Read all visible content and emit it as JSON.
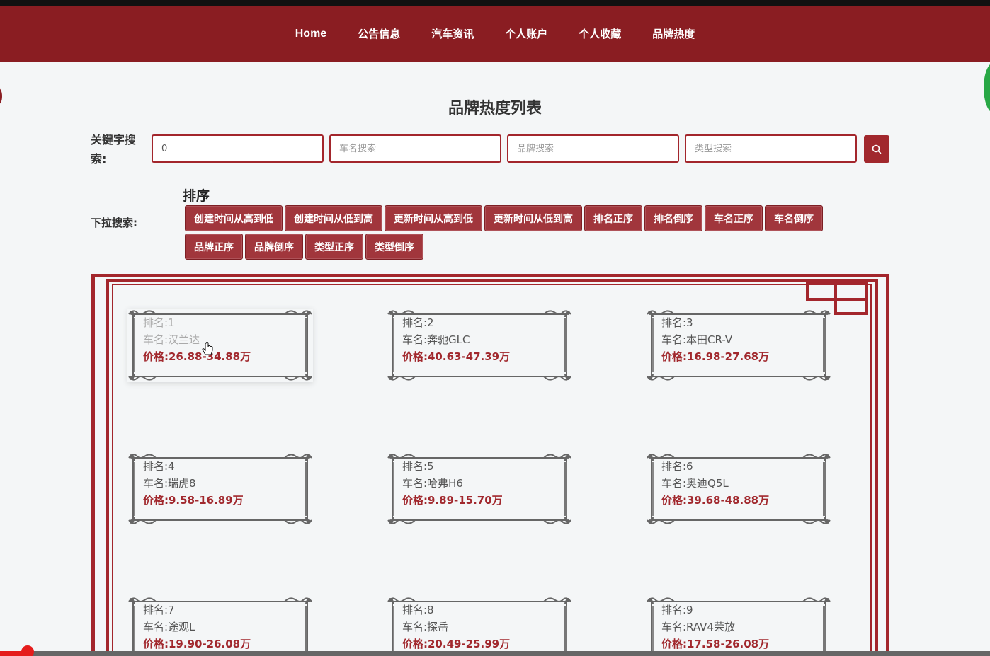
{
  "nav": {
    "items": [
      {
        "label": "Home"
      },
      {
        "label": "公告信息"
      },
      {
        "label": "汽车资讯"
      },
      {
        "label": "个人账户"
      },
      {
        "label": "个人收藏"
      },
      {
        "label": "品牌热度"
      }
    ]
  },
  "page": {
    "title": "品牌热度列表"
  },
  "search": {
    "label": "关键字搜索:",
    "keyword_value": "0",
    "car_placeholder": "车名搜索",
    "brand_placeholder": "品牌搜索",
    "type_placeholder": "类型搜索",
    "button_icon": "search-icon"
  },
  "sort": {
    "title": "排序",
    "label": "下拉搜索:",
    "buttons": [
      "创建时间从高到低",
      "创建时间从低到高",
      "更新时间从高到低",
      "更新时间从低到高",
      "排名正序",
      "排名倒序",
      "车名正序",
      "车名倒序",
      "品牌正序",
      "品牌倒序",
      "类型正序",
      "类型倒序"
    ]
  },
  "cards": [
    {
      "rank": "排名:1",
      "name": "车名:汉兰达",
      "price": "价格:26.88-34.88万"
    },
    {
      "rank": "排名:2",
      "name": "车名:奔驰GLC",
      "price": "价格:40.63-47.39万"
    },
    {
      "rank": "排名:3",
      "name": "车名:本田CR-V",
      "price": "价格:16.98-27.68万"
    },
    {
      "rank": "排名:4",
      "name": "车名:瑞虎8",
      "price": "价格:9.58-16.89万"
    },
    {
      "rank": "排名:5",
      "name": "车名:哈弗H6",
      "price": "价格:9.89-15.70万"
    },
    {
      "rank": "排名:6",
      "name": "车名:奥迪Q5L",
      "price": "价格:39.68-48.88万"
    },
    {
      "rank": "排名:7",
      "name": "车名:途观L",
      "price": "价格:19.90-26.08万"
    },
    {
      "rank": "排名:8",
      "name": "车名:探岳",
      "price": "价格:20.49-25.99万"
    },
    {
      "rank": "排名:9",
      "name": "车名:RAV4荣放",
      "price": "价格:17.58-26.08万"
    }
  ],
  "colors": {
    "brand": "#8a1d22",
    "accent": "#a1282d",
    "background": "#f4f6f7"
  },
  "video": {
    "progress": 0.028
  }
}
